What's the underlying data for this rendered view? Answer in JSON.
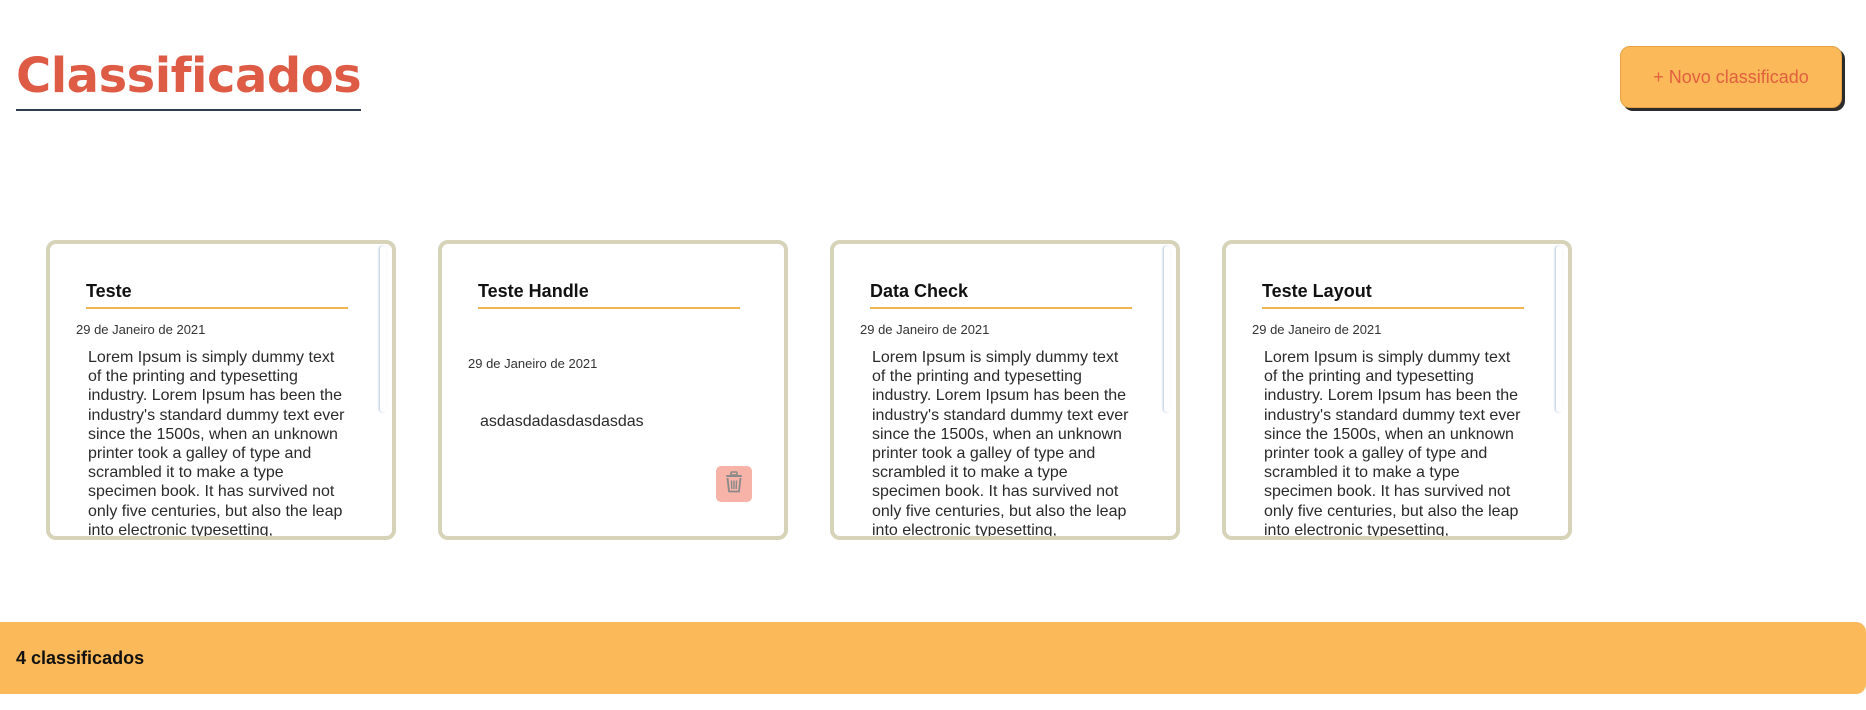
{
  "header": {
    "title": "Classificados",
    "new_button_label": "+ Novo classificado"
  },
  "cards": [
    {
      "title": "Teste",
      "date": "29 de Janeiro de 2021",
      "body": "Lorem Ipsum is simply dummy text of the printing and typesetting industry. Lorem Ipsum has been the industry's standard dummy text ever since the 1500s, when an unknown printer took a galley of type and scrambled it to make a type specimen book. It has survived not only five centuries, but also the leap into electronic typesetting,"
    },
    {
      "title": "Teste Handle",
      "date": "29 de Janeiro de 2021",
      "body": "asdasdadasdasdasdas",
      "delete_icon": "trash-icon"
    },
    {
      "title": "Data Check",
      "date": "29 de Janeiro de 2021",
      "body": "Lorem Ipsum is simply dummy text of the printing and typesetting industry. Lorem Ipsum has been the industry's standard dummy text ever since the 1500s, when an unknown printer took a galley of type and scrambled it to make a type specimen book. It has survived not only five centuries, but also the leap into electronic typesetting,"
    },
    {
      "title": "Teste Layout",
      "date": "29 de Janeiro de 2021",
      "body": "Lorem Ipsum is simply dummy text of the printing and typesetting industry. Lorem Ipsum has been the industry's standard dummy text ever since the 1500s, when an unknown printer took a galley of type and scrambled it to make a type specimen book. It has survived not only five centuries, but also the leap into electronic typesetting,"
    }
  ],
  "footer": {
    "count_label": "4 classificados"
  },
  "colors": {
    "title": "#de5b45",
    "accent": "#fbb95a",
    "card_border": "#d6d3b9",
    "delete": "#f7b3a8"
  }
}
